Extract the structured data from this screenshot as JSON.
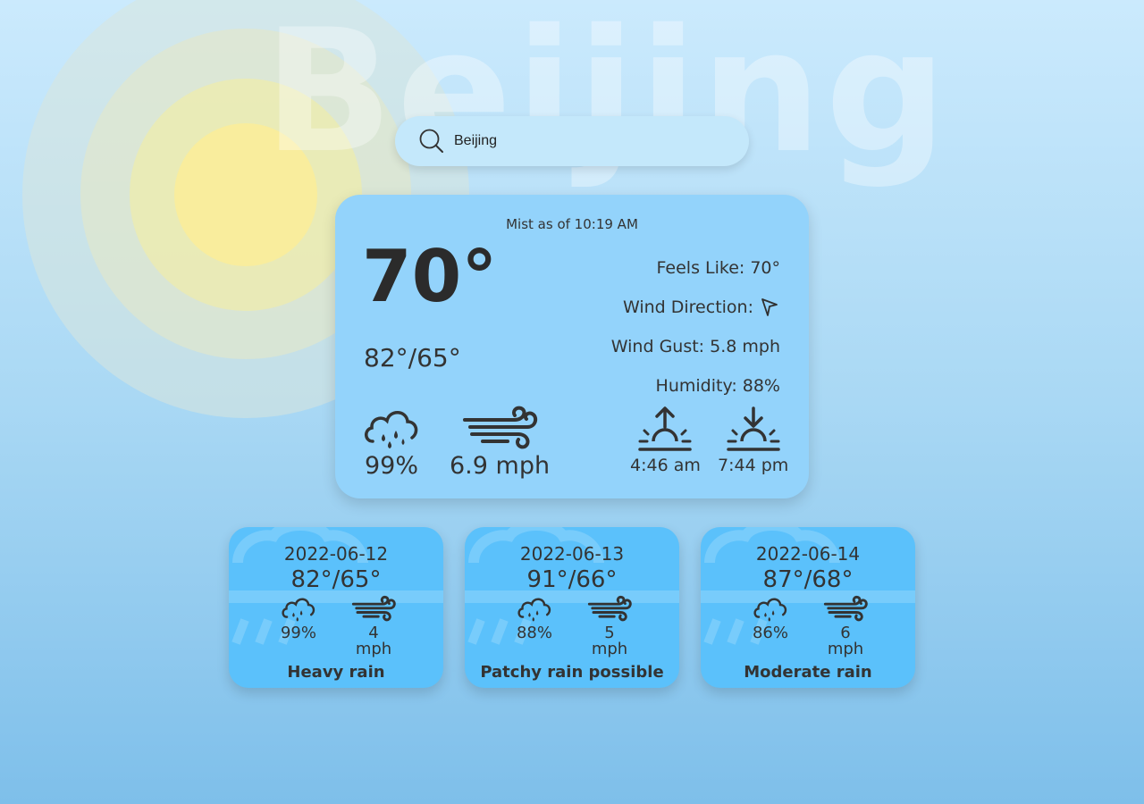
{
  "city_watermark": "Beijing",
  "search": {
    "value": "Beijing",
    "placeholder": ""
  },
  "current": {
    "condition_line": "Mist as of 10:19 AM",
    "temperature": "70°",
    "high_low": "82°/65°",
    "feels_like": "Feels Like: 70°",
    "wind_direction_label": "Wind Direction:",
    "wind_gust": "Wind Gust: 5.8 mph",
    "humidity": "Humidity: 88%",
    "chance_of_rain": "99%",
    "wind_speed": "6.9 mph",
    "sunrise": "4:46 am",
    "sunset": "7:44 pm"
  },
  "forecast": [
    {
      "date": "2022-06-12",
      "temps": "82°/65°",
      "rain": "99%",
      "wind": "4 mph",
      "condition": "Heavy rain"
    },
    {
      "date": "2022-06-13",
      "temps": "91°/66°",
      "rain": "88%",
      "wind": "5 mph",
      "condition": "Patchy rain possible"
    },
    {
      "date": "2022-06-14",
      "temps": "87°/68°",
      "rain": "86%",
      "wind": "6 mph",
      "condition": "Moderate rain"
    }
  ],
  "icons": {
    "search": "search-icon",
    "wind_direction": "navigation-arrow-icon",
    "rain": "cloud-rain-icon",
    "wind": "wind-icon",
    "sunrise": "sunrise-icon",
    "sunset": "sunset-icon"
  },
  "colors": {
    "main_card": "#93d3fb",
    "forecast_card": "#5bc1fb",
    "search_bar": "#c4e8fb",
    "sun": "#fcee96"
  }
}
